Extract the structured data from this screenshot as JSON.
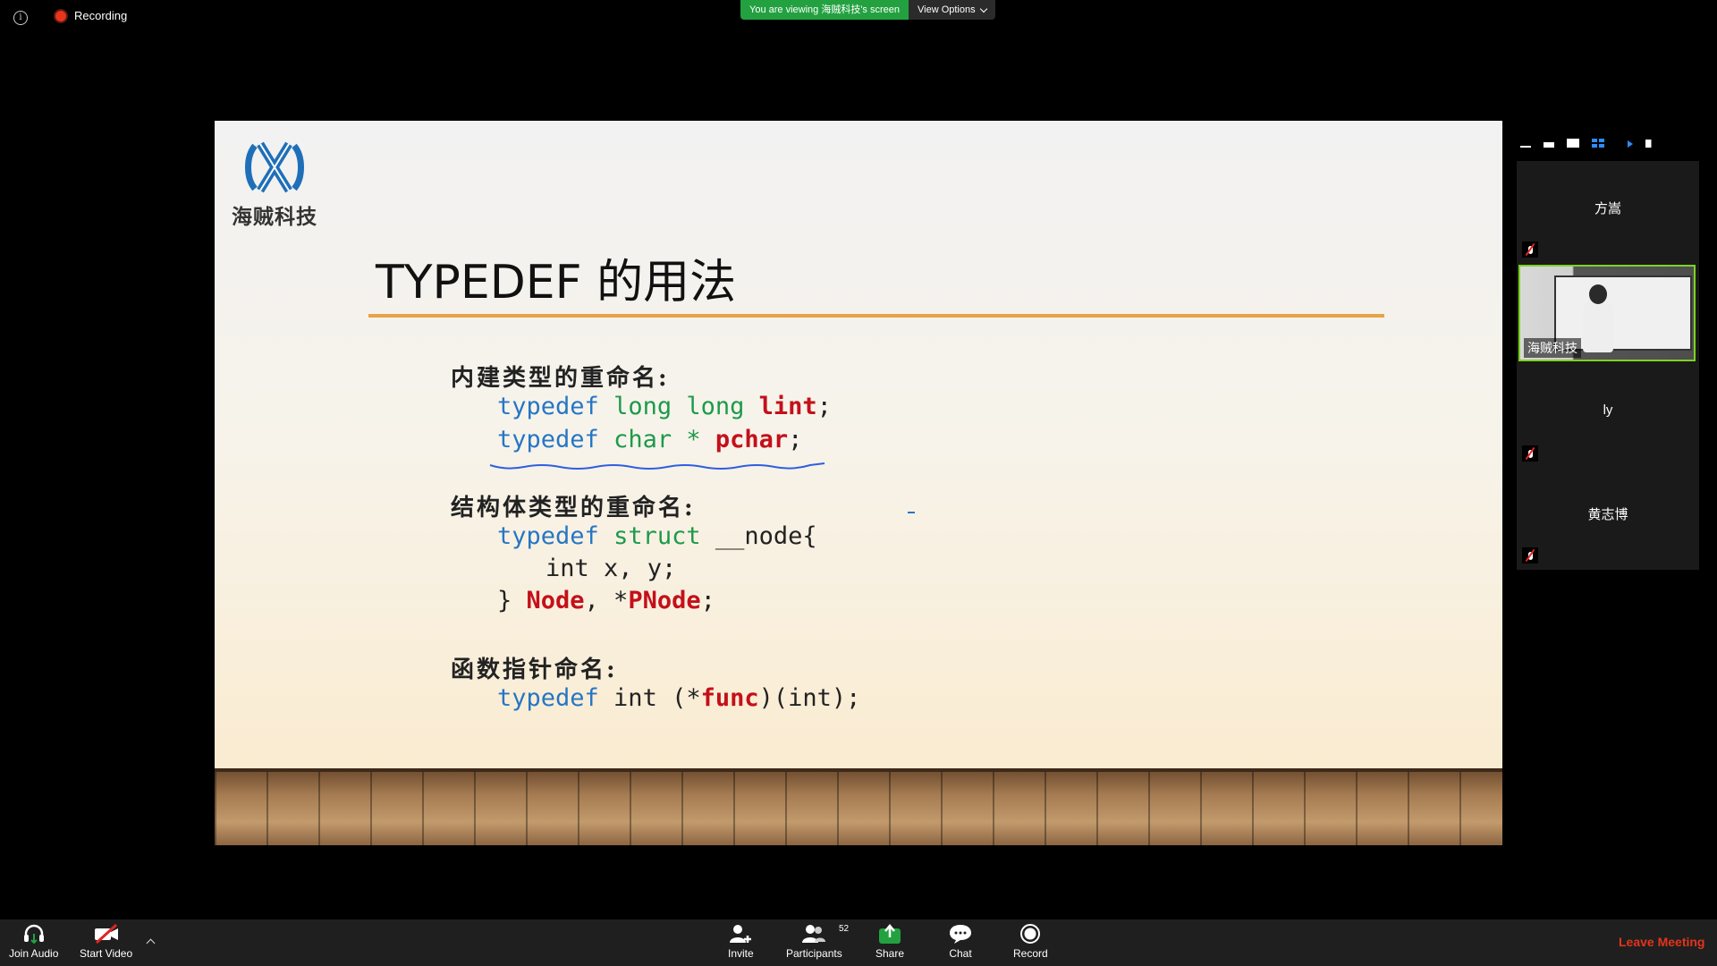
{
  "topbar": {
    "recording_label": "Recording",
    "viewing_label": "You are viewing 海贼科技's screen",
    "view_options_label": "View Options"
  },
  "slide": {
    "logo_text": "海贼科技",
    "title": "TYPEDEF 的用法",
    "section1_label": "内建类型的重命名:",
    "section2_label": "结构体类型的重命名:",
    "section3_label": "函数指针命名:",
    "code": {
      "kw_typedef": "typedef",
      "long_long": "long long",
      "lint": "lint",
      "char_star": "char *",
      "pchar": "pchar",
      "struct_kw": "struct",
      "node_open": " __node{",
      "int_xy": "int x, y;",
      "close_brace": "} ",
      "Node": "Node",
      "comma_star": ", *",
      "PNode": "PNode",
      "semi": ";",
      "int_open": " int (*",
      "func": "func",
      "func_tail": ")(int);"
    },
    "colors": {
      "keyword": "#2676c4",
      "type": "#1d9a4a",
      "name": "#c4101a",
      "title_rule": "#e9a246"
    }
  },
  "participants": [
    {
      "name": "方嵩",
      "muted": true
    },
    {
      "name": "海贼科技",
      "active_speaker": true
    },
    {
      "name": "ly",
      "muted": true
    },
    {
      "name": "黄志博",
      "muted": true
    }
  ],
  "toolbar": {
    "join_audio": "Join Audio",
    "start_video": "Start Video",
    "invite": "Invite",
    "participants": "Participants",
    "participants_count": "52",
    "share": "Share",
    "chat": "Chat",
    "record": "Record",
    "leave": "Leave Meeting"
  },
  "accent": {
    "green": "#23a140",
    "active_border": "#7ed321",
    "leave_red": "#e3341c"
  }
}
